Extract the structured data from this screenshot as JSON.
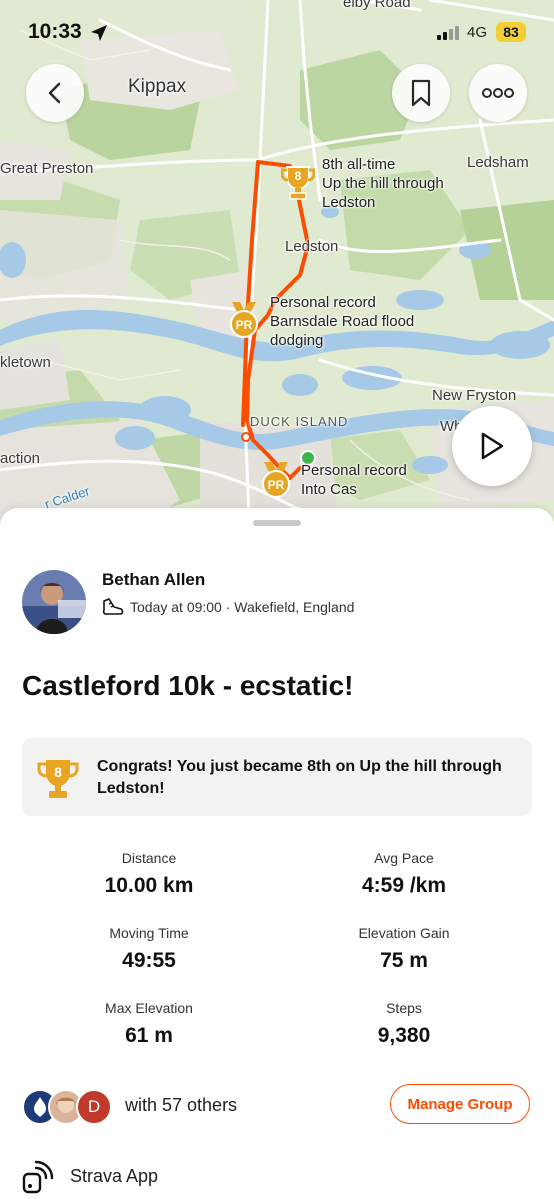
{
  "status_bar": {
    "time": "10:33",
    "network": "4G",
    "battery": "83"
  },
  "map": {
    "labels": {
      "top_road": "elby Road",
      "kippax": "Kippax",
      "great_preston": "Great Preston",
      "ledsham": "Ledsham",
      "ledston": "Ledston",
      "kletown": "kletown",
      "new_fryston": "New Fryston",
      "wh": "Wh",
      "duck_island": "DUCK ISLAND",
      "action": "action",
      "river": "r Calder"
    },
    "segments": [
      {
        "badge": "8",
        "line1": "8th all-time",
        "line2": "Up the hill through",
        "line3": "Ledston"
      },
      {
        "badge": "PR",
        "line1": "Personal record",
        "line2": "Barnsdale Road flood",
        "line3": "dodging"
      },
      {
        "badge": "PR",
        "line1": "Personal record",
        "line2": "Into Cas"
      }
    ],
    "colors": {
      "route": "#fc4c02",
      "trophy": "#e7a523"
    }
  },
  "activity": {
    "athlete": "Bethan Allen",
    "meta": "Today at 09:00 · Wakefield, England",
    "title": "Castleford 10k - ecstatic!",
    "congrats": "Congrats! You just became 8th on Up the hill through Ledston!",
    "congrats_rank": "8",
    "stats": [
      {
        "label": "Distance",
        "value": "10.00 km"
      },
      {
        "label": "Avg Pace",
        "value": "4:59 /km"
      },
      {
        "label": "Moving Time",
        "value": "49:55"
      },
      {
        "label": "Elevation Gain",
        "value": "75 m"
      },
      {
        "label": "Max Elevation",
        "value": "61 m"
      },
      {
        "label": "Steps",
        "value": "9,380"
      }
    ],
    "group": {
      "text": "with 57 others",
      "avatar_initial": "D",
      "manage_label": "Manage Group"
    },
    "device": "Strava App"
  },
  "icons": {
    "back": "chevron-left-icon",
    "bookmark": "bookmark-icon",
    "more": "more-icon",
    "play": "play-icon",
    "shoe": "shoe-icon",
    "trophy": "trophy-icon",
    "device": "watch-icon"
  }
}
